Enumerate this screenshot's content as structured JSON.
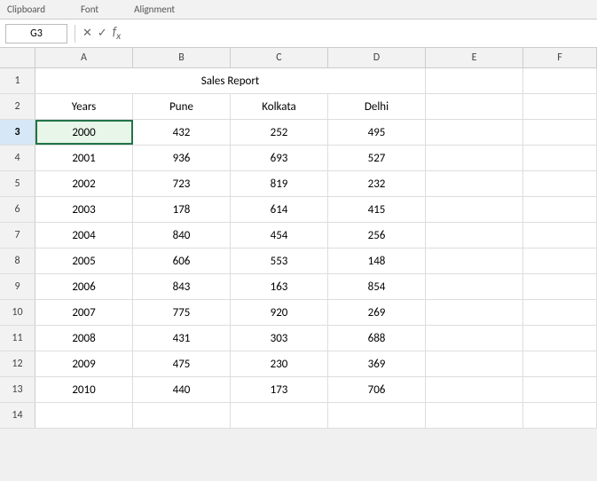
{
  "toolbar": {
    "clipboard_label": "Clipboard",
    "font_label": "Font",
    "alignment_label": "Alignment"
  },
  "formula_bar": {
    "cell_ref": "G3",
    "formula_placeholder": ""
  },
  "spreadsheet": {
    "title": "Sales Report",
    "col_headers": [
      "A",
      "B",
      "C",
      "D",
      "E",
      "F"
    ],
    "headers": [
      "Years",
      "Pune",
      "Kolkata",
      "Delhi"
    ],
    "rows": [
      {
        "row": 3,
        "year": "2000",
        "pune": "432",
        "kolkata": "252",
        "delhi": "495",
        "active": true
      },
      {
        "row": 4,
        "year": "2001",
        "pune": "936",
        "kolkata": "693",
        "delhi": "527",
        "active": false
      },
      {
        "row": 5,
        "year": "2002",
        "pune": "723",
        "kolkata": "819",
        "delhi": "232",
        "active": false
      },
      {
        "row": 6,
        "year": "2003",
        "pune": "178",
        "kolkata": "614",
        "delhi": "415",
        "active": false
      },
      {
        "row": 7,
        "year": "2004",
        "pune": "840",
        "kolkata": "454",
        "delhi": "256",
        "active": false
      },
      {
        "row": 8,
        "year": "2005",
        "pune": "606",
        "kolkata": "553",
        "delhi": "148",
        "active": false
      },
      {
        "row": 9,
        "year": "2006",
        "pune": "843",
        "kolkata": "163",
        "delhi": "854",
        "active": false
      },
      {
        "row": 10,
        "year": "2007",
        "pune": "775",
        "kolkata": "920",
        "delhi": "269",
        "active": false
      },
      {
        "row": 11,
        "year": "2008",
        "pune": "431",
        "kolkata": "303",
        "delhi": "688",
        "active": false
      },
      {
        "row": 12,
        "year": "2009",
        "pune": "475",
        "kolkata": "230",
        "delhi": "369",
        "active": false
      },
      {
        "row": 13,
        "year": "2010",
        "pune": "440",
        "kolkata": "173",
        "delhi": "706",
        "active": false
      }
    ]
  }
}
